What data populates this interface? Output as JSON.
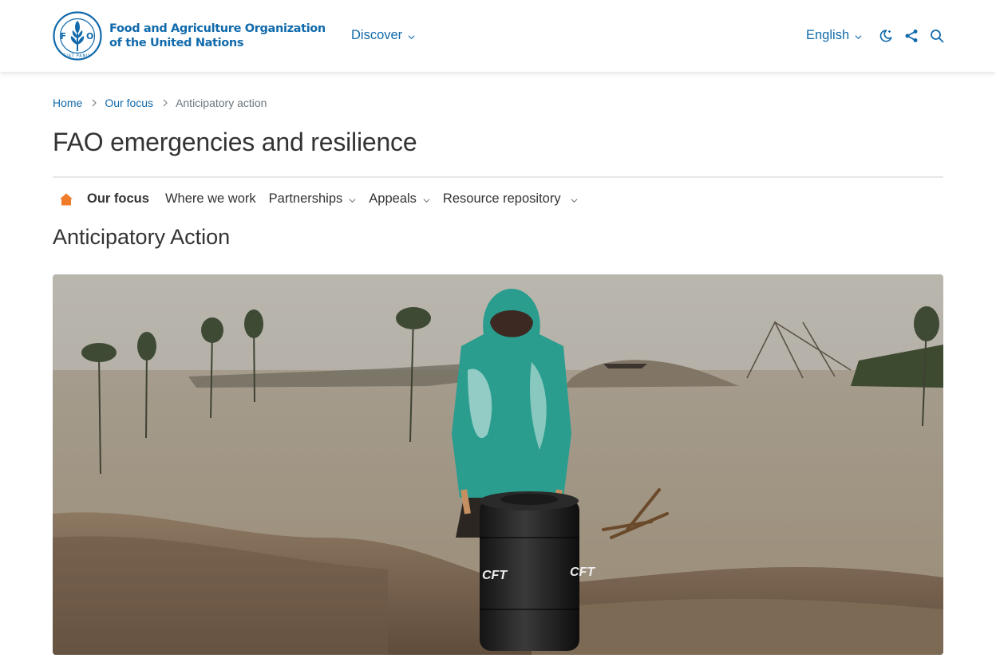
{
  "header": {
    "logo_line1": "Food and Agriculture Organization",
    "logo_line2": "of the United Nations",
    "logo_emblem_letters": "FAO",
    "logo_motto": "FIAT PANIS",
    "discover_label": "Discover",
    "language_label": "English",
    "icons": [
      "dark-mode-icon",
      "share-icon",
      "search-icon"
    ],
    "brand_color": "#116aab"
  },
  "breadcrumb": {
    "items": [
      "Home",
      "Our focus"
    ],
    "current": "Anticipatory action"
  },
  "site_title": "FAO emergencies and resilience",
  "subnav": {
    "home_icon": "home-icon",
    "home_icon_color": "#f07c2b",
    "items": [
      {
        "label": "Our focus"
      },
      {
        "label": "Where we work"
      },
      {
        "label": "Partnerships"
      },
      {
        "label": "Appeals"
      },
      {
        "label": "Resource repository"
      }
    ]
  },
  "page_title": "Anticipatory Action",
  "hero": {
    "barrel_text": "CFT"
  }
}
